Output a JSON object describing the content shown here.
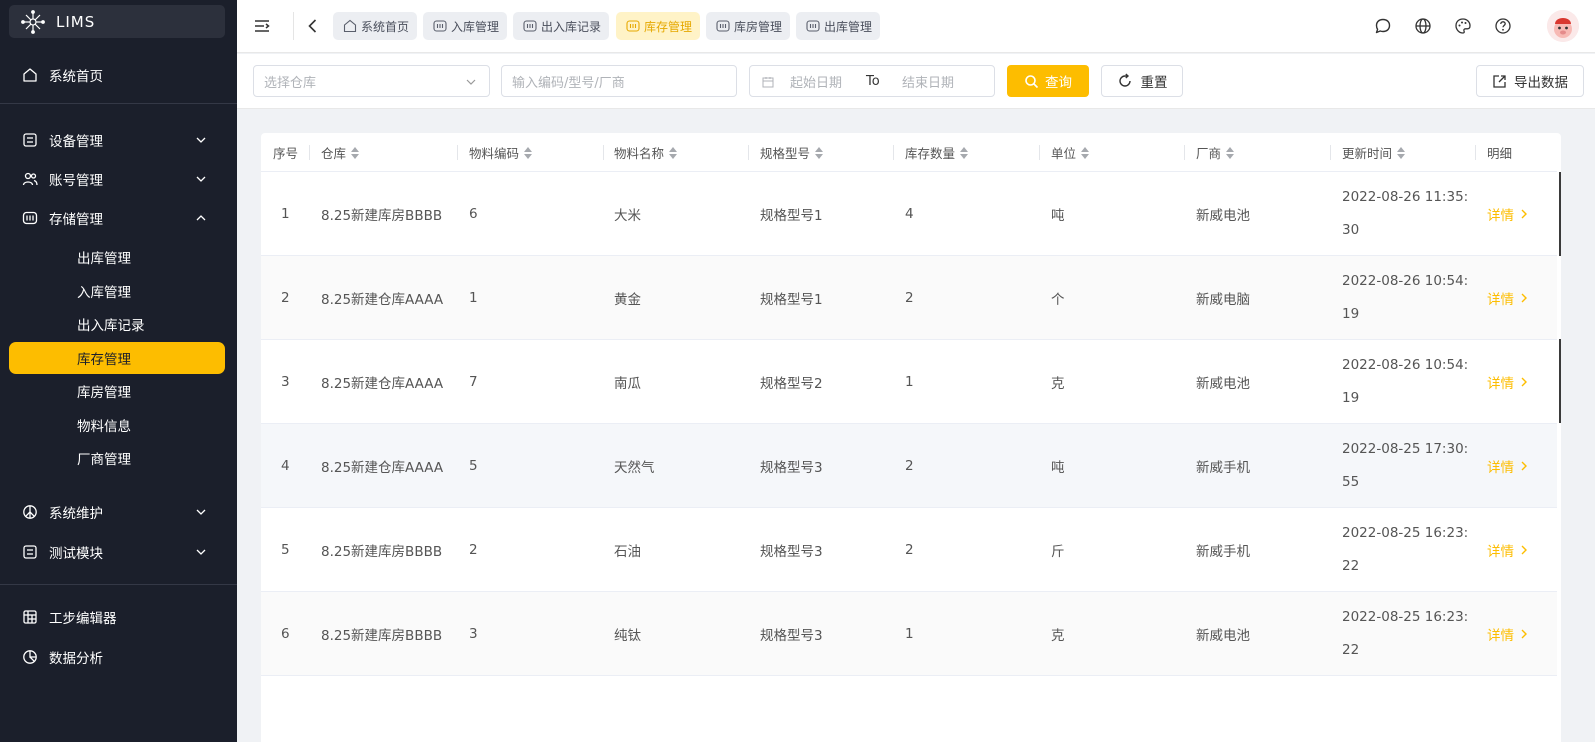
{
  "app": {
    "title": "LIMS"
  },
  "sidebar": {
    "items": [
      {
        "label": "系统首页",
        "icon": "home-icon"
      },
      {
        "label": "设备管理",
        "icon": "device-icon"
      },
      {
        "label": "账号管理",
        "icon": "users-icon"
      },
      {
        "label": "存储管理",
        "icon": "storage-icon"
      },
      {
        "label": "系统维护",
        "icon": "maintenance-icon"
      },
      {
        "label": "测试模块",
        "icon": "test-icon"
      },
      {
        "label": "工步编辑器",
        "icon": "grid-icon"
      },
      {
        "label": "数据分析",
        "icon": "chart-icon"
      }
    ],
    "storage_sub": [
      {
        "label": "出库管理"
      },
      {
        "label": "入库管理"
      },
      {
        "label": "出入库记录"
      },
      {
        "label": "库存管理",
        "active": true
      },
      {
        "label": "库房管理"
      },
      {
        "label": "物料信息"
      },
      {
        "label": "厂商管理"
      }
    ]
  },
  "tabs": [
    {
      "label": "系统首页",
      "icon": "home-icon"
    },
    {
      "label": "入库管理",
      "icon": "storage-icon"
    },
    {
      "label": "出入库记录",
      "icon": "storage-icon"
    },
    {
      "label": "库存管理",
      "icon": "storage-icon",
      "active": true
    },
    {
      "label": "库房管理",
      "icon": "storage-icon"
    },
    {
      "label": "出库管理",
      "icon": "storage-icon"
    }
  ],
  "filters": {
    "warehouse_placeholder": "选择仓库",
    "search_placeholder": "输入编码/型号/厂商",
    "start_date_placeholder": "起始日期",
    "to_label": "To",
    "end_date_placeholder": "结束日期",
    "query_label": "查询",
    "reset_label": "重置",
    "export_label": "导出数据"
  },
  "table": {
    "headers": [
      "序号",
      "仓库",
      "物料编码",
      "物料名称",
      "规格型号",
      "库存数量",
      "单位",
      "厂商",
      "更新时间",
      "明细"
    ],
    "detail_label": "详情",
    "rows": [
      [
        "1",
        "8.25新建库房BBBB",
        "6",
        "大米",
        "规格型号1",
        "4",
        "吨",
        "新威电池",
        "2022-08-26 11:35:30"
      ],
      [
        "2",
        "8.25新建仓库AAAA",
        "1",
        "黄金",
        "规格型号1",
        "2",
        "个",
        "新威电脑",
        "2022-08-26 10:54:19"
      ],
      [
        "3",
        "8.25新建仓库AAAA",
        "7",
        "南瓜",
        "规格型号2",
        "1",
        "克",
        "新威电池",
        "2022-08-26 10:54:19"
      ],
      [
        "4",
        "8.25新建仓库AAAA",
        "5",
        "天然气",
        "规格型号3",
        "2",
        "吨",
        "新威手机",
        "2022-08-25 17:30:55"
      ],
      [
        "5",
        "8.25新建库房BBBB",
        "2",
        "石油",
        "规格型号3",
        "2",
        "斤",
        "新威手机",
        "2022-08-25 16:23:22"
      ],
      [
        "6",
        "8.25新建库房BBBB",
        "3",
        "纯钛",
        "规格型号3",
        "1",
        "克",
        "新威电池",
        "2022-08-25 16:23:22"
      ]
    ]
  },
  "colors": {
    "accent": "#fdbd00",
    "sidebar_bg": "#1b1f2b"
  }
}
